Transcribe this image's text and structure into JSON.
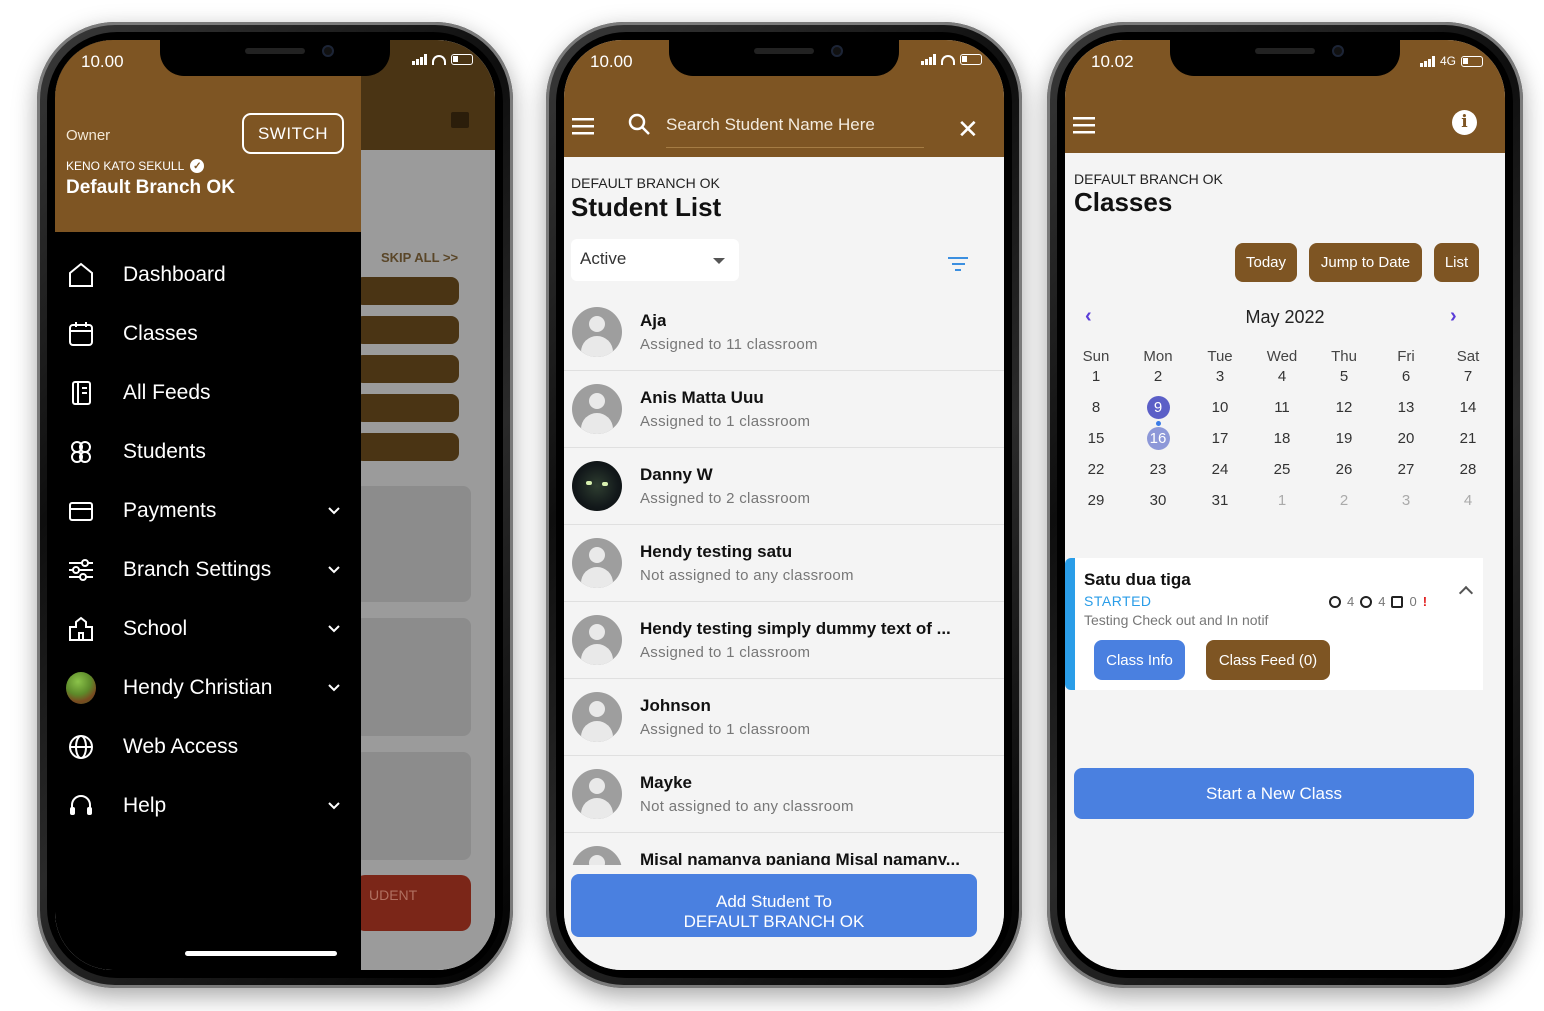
{
  "colors": {
    "brand": "#7e5523",
    "accent": "#4a80e0",
    "drawer": "#000000",
    "started": "#2a9de8",
    "calendar_selected": "#5b5fc7"
  },
  "phone1": {
    "status_time": "10.00",
    "header": {
      "role": "Owner",
      "switch_label": "SWITCH",
      "school": "KENO KATO SEKULL",
      "branch": "Default Branch OK"
    },
    "background": {
      "skip_label": "SKIP ALL >>",
      "button_partial": "UDENT"
    },
    "menu": [
      {
        "label": "Dashboard",
        "icon": "home-icon",
        "expandable": false
      },
      {
        "label": "Classes",
        "icon": "calendar-icon",
        "expandable": false
      },
      {
        "label": "All Feeds",
        "icon": "notebook-icon",
        "expandable": false
      },
      {
        "label": "Students",
        "icon": "students-icon",
        "expandable": false
      },
      {
        "label": "Payments",
        "icon": "wallet-icon",
        "expandable": true
      },
      {
        "label": "Branch Settings",
        "icon": "sliders-icon",
        "expandable": true
      },
      {
        "label": "School",
        "icon": "school-icon",
        "expandable": true
      },
      {
        "label": "Hendy  Christian",
        "icon": "avatar",
        "expandable": true
      },
      {
        "label": "Web Access",
        "icon": "globe-icon",
        "expandable": false
      },
      {
        "label": "Help",
        "icon": "headset-icon",
        "expandable": true
      }
    ]
  },
  "phone2": {
    "status_time": "10.00",
    "search_placeholder": "Search Student Name Here",
    "branch": "DEFAULT BRANCH OK",
    "title": "Student List",
    "filter_value": "Active",
    "students": [
      {
        "name": "Aja",
        "sub": "Assigned to 11 classroom",
        "photo": false
      },
      {
        "name": "Anis Matta Uuu",
        "sub": "Assigned to 1 classroom",
        "photo": false
      },
      {
        "name": "Danny W",
        "sub": "Assigned to 2 classroom",
        "photo": true
      },
      {
        "name": "Hendy testing satu",
        "sub": "Not assigned to any classroom",
        "photo": false
      },
      {
        "name": "Hendy testing simply dummy text of ...",
        "sub": "Assigned to 1 classroom",
        "photo": false
      },
      {
        "name": "Johnson",
        "sub": "Assigned to 1 classroom",
        "photo": false
      },
      {
        "name": "Mayke",
        "sub": "Not assigned to any classroom",
        "photo": false
      },
      {
        "name": "Misal namanya panjang Misal namany...",
        "sub": "",
        "photo": false
      }
    ],
    "add_button_line1": "Add Student To",
    "add_button_line2": "DEFAULT BRANCH OK"
  },
  "phone3": {
    "status_time": "10.02",
    "network": "4G",
    "branch": "DEFAULT BRANCH OK",
    "title": "Classes",
    "buttons": {
      "today": "Today",
      "jump": "Jump to Date",
      "list": "List"
    },
    "calendar": {
      "month": "May 2022",
      "dows": [
        "Sun",
        "Mon",
        "Tue",
        "Wed",
        "Thu",
        "Fri",
        "Sat"
      ],
      "weeks": [
        [
          "1",
          "2",
          "3",
          "4",
          "5",
          "6",
          "7"
        ],
        [
          "8",
          "9",
          "10",
          "11",
          "12",
          "13",
          "14"
        ],
        [
          "15",
          "16",
          "17",
          "18",
          "19",
          "20",
          "21"
        ],
        [
          "22",
          "23",
          "24",
          "25",
          "26",
          "27",
          "28"
        ],
        [
          "29",
          "30",
          "31",
          "1",
          "2",
          "3",
          "4"
        ]
      ],
      "selected": "9",
      "secondary": "16"
    },
    "class_card": {
      "name": "Satu dua tiga",
      "status": "STARTED",
      "desc": "Testing Check out and In notif",
      "count1": "4",
      "count2": "4",
      "count3": "0",
      "alert": "!",
      "info_button": "Class Info",
      "feed_button": "Class Feed (0)"
    },
    "start_button": "Start a New Class"
  }
}
